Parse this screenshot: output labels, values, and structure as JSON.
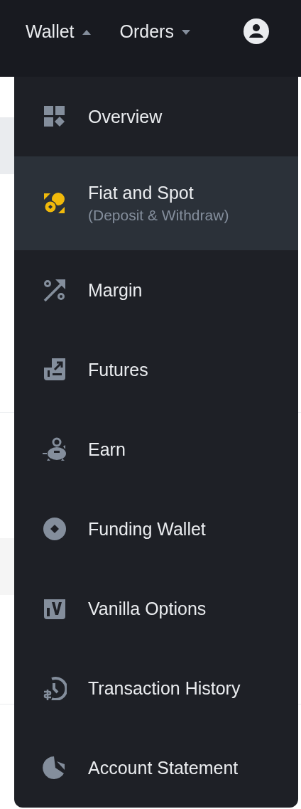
{
  "nav": [
    {
      "label": "Wallet",
      "expanded": true
    },
    {
      "label": "Orders",
      "expanded": false
    }
  ],
  "menu": [
    {
      "title": "Overview",
      "selected": false
    },
    {
      "title": "Fiat and Spot",
      "subtitle": "(Deposit & Withdraw)",
      "selected": true
    },
    {
      "title": "Margin",
      "selected": false
    },
    {
      "title": "Futures",
      "selected": false
    },
    {
      "title": "Earn",
      "selected": false
    },
    {
      "title": "Funding Wallet",
      "selected": false
    },
    {
      "title": "Vanilla Options",
      "selected": false
    },
    {
      "title": "Transaction History",
      "selected": false
    },
    {
      "title": "Account Statement",
      "selected": false
    }
  ]
}
